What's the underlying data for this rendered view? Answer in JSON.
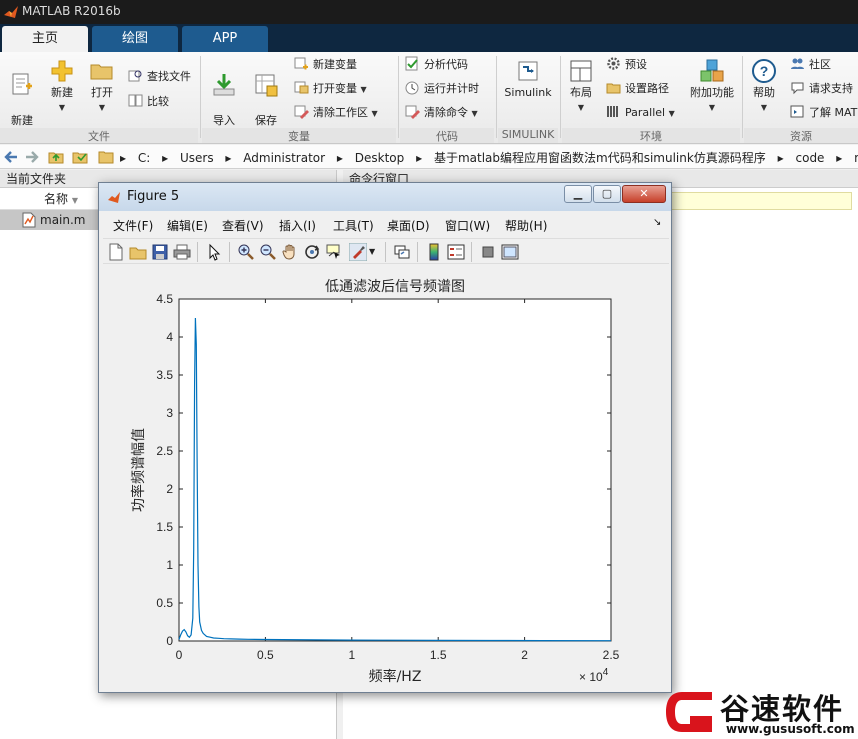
{
  "app": {
    "title": "MATLAB R2016b"
  },
  "tabs": [
    {
      "label": "主页",
      "active": true
    },
    {
      "label": "绘图",
      "active": false
    },
    {
      "label": "APP",
      "active": false
    }
  ],
  "ribbon": {
    "file": {
      "group_label": "文件",
      "new_script": "新建\n脚本",
      "new": "新建",
      "open": "打开",
      "find_files": "查找文件",
      "compare": "比较"
    },
    "variable": {
      "group_label": "变量",
      "import_data": "导入\n数据",
      "save_workspace": "保存\n工作区",
      "new_variable": "新建变量",
      "open_variable": "打开变量",
      "clear_workspace": "清除工作区"
    },
    "code": {
      "group_label": "代码",
      "analyze_code": "分析代码",
      "run_and_time": "运行并计时",
      "clear_commands": "清除命令"
    },
    "simulink": {
      "group_label": "SIMULINK",
      "label": "Simulink"
    },
    "environment": {
      "group_label": "环境",
      "layout": "布局",
      "preferences": "预设",
      "set_path": "设置路径",
      "parallel": "Parallel",
      "addons": "附加功能"
    },
    "resources": {
      "group_label": "资源",
      "help": "帮助",
      "community": "社区",
      "request_support": "请求支持",
      "learn_matlab": "了解 MAT"
    }
  },
  "address": {
    "path": [
      "C:",
      "Users",
      "Administrator",
      "Desktop",
      "基于matlab编程应用窗函数法m代码和simulink仿真源码程序",
      "code",
      "matlab"
    ]
  },
  "current_folder": {
    "title": "当前文件夹",
    "name_header": "名称",
    "files": [
      "main.m"
    ]
  },
  "command_window": {
    "title": "命令行窗口"
  },
  "figure": {
    "title": "Figure 5",
    "menu": [
      "文件(F)",
      "编辑(E)",
      "查看(V)",
      "插入(I)",
      "工具(T)",
      "桌面(D)",
      "窗口(W)",
      "帮助(H)"
    ],
    "toolbar_icons": [
      "new-figure-icon",
      "open-file-icon",
      "save-icon",
      "print-icon",
      "pointer-icon",
      "zoom-in-icon",
      "zoom-out-icon",
      "pan-icon",
      "rotate-icon",
      "data-cursor-icon",
      "brush-icon",
      "link-plot-icon",
      "colorbar-icon",
      "legend-icon",
      "hide-plot-tools-icon",
      "show-plot-tools-icon"
    ]
  },
  "chart_data": {
    "type": "line",
    "title": "低通滤波后信号频谱图",
    "xlabel": "频率/HZ",
    "ylabel": "功率频谱幅值",
    "xlim": [
      0,
      25000
    ],
    "ylim": [
      0,
      4.5
    ],
    "x_exponent_label": "× 10",
    "x_exponent_power": "4",
    "xticks": [
      0,
      5000,
      10000,
      15000,
      20000,
      25000
    ],
    "xtick_labels": [
      "0",
      "0.5",
      "1",
      "1.5",
      "2",
      "2.5"
    ],
    "yticks": [
      0,
      0.5,
      1,
      1.5,
      2,
      2.5,
      3,
      3.5,
      4,
      4.5
    ],
    "ytick_labels": [
      "0",
      "0.5",
      "1",
      "1.5",
      "2",
      "2.5",
      "3",
      "3.5",
      "4",
      "4.5"
    ],
    "line_color": "#0072bd",
    "series": [
      {
        "x": [
          0,
          100,
          200,
          300,
          400,
          500,
          600,
          700,
          800,
          850,
          900,
          950,
          1000,
          1050,
          1100,
          1150,
          1200,
          1300,
          1400,
          1500,
          1600,
          1800,
          2000,
          2300,
          2600,
          3000,
          3500,
          4000,
          5000,
          6000,
          8000,
          10000,
          12000,
          15000,
          18000,
          21000,
          25000
        ],
        "y": [
          0.02,
          0.08,
          0.13,
          0.15,
          0.12,
          0.07,
          0.05,
          0.08,
          0.3,
          1.2,
          3.4,
          4.25,
          3.9,
          2.4,
          1.0,
          0.45,
          0.25,
          0.14,
          0.1,
          0.08,
          0.06,
          0.05,
          0.04,
          0.035,
          0.03,
          0.028,
          0.025,
          0.022,
          0.02,
          0.018,
          0.015,
          0.012,
          0.01,
          0.008,
          0.006,
          0.005,
          0.004
        ]
      }
    ]
  },
  "watermark": {
    "text": "谷速软件",
    "url": "www.gususoft.com"
  }
}
